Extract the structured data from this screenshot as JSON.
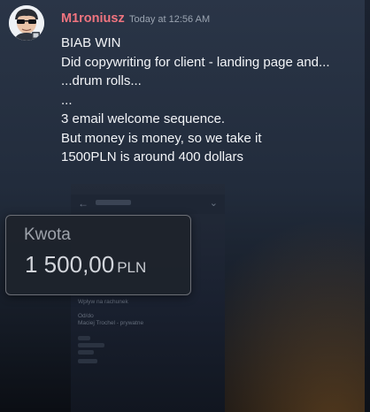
{
  "message": {
    "username": "M1roniusz",
    "timestamp": "Today at 12:56 AM",
    "lines": [
      "BIAB WIN",
      "Did copywriting for client - landing page and...",
      "...drum rolls...",
      "...",
      "3 email welcome sequence.",
      "But money is money, so we take it",
      "1500PLN is around 400 dollars"
    ],
    "avatar_icon": "sunglasses-avatar-icon"
  },
  "attachment": {
    "amount_card": {
      "label": "Kwota",
      "value": "1 500,00",
      "currency": "PLN"
    },
    "screenshot_lines": [
      "Wpływ na rachunek",
      "Od/do",
      "Maciej Trochel - prywatne"
    ]
  },
  "colors": {
    "username": "#f0747f",
    "message_text": "#f2f4f7",
    "timestamp": "#9aa3b0",
    "background_top": "#2a3547"
  }
}
